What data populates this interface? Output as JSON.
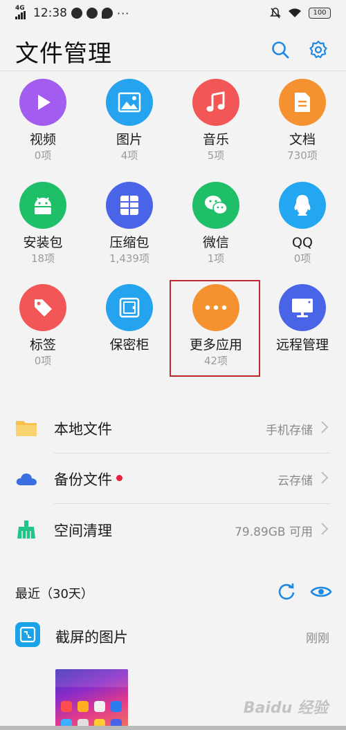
{
  "status_bar": {
    "network": "4G",
    "time": "12:38",
    "more": "···",
    "battery": "100"
  },
  "header": {
    "title": "文件管理"
  },
  "categories": [
    {
      "label": "视频",
      "count": "0项",
      "color": "#a35cf0",
      "icon": "play-icon"
    },
    {
      "label": "图片",
      "count": "4项",
      "color": "#26a3ef",
      "icon": "image-icon"
    },
    {
      "label": "音乐",
      "count": "5项",
      "color": "#f25656",
      "icon": "music-icon"
    },
    {
      "label": "文档",
      "count": "730项",
      "color": "#f5922f",
      "icon": "document-icon"
    },
    {
      "label": "安装包",
      "count": "18项",
      "color": "#1fbf6a",
      "icon": "android-icon"
    },
    {
      "label": "压缩包",
      "count": "1,439项",
      "color": "#4a64e8",
      "icon": "archive-icon"
    },
    {
      "label": "微信",
      "count": "1项",
      "color": "#1fbf6a",
      "icon": "wechat-icon"
    },
    {
      "label": "QQ",
      "count": "0项",
      "color": "#22a7f0",
      "icon": "qq-icon"
    },
    {
      "label": "标签",
      "count": "0项",
      "color": "#f25656",
      "icon": "tag-icon"
    },
    {
      "label": "保密柜",
      "count": "",
      "color": "#26a3ef",
      "icon": "safe-icon"
    },
    {
      "label": "更多应用",
      "count": "42项",
      "color": "#f5922f",
      "icon": "more-icon"
    },
    {
      "label": "远程管理",
      "count": "",
      "color": "#4a64e8",
      "icon": "monitor-icon"
    }
  ],
  "rows": [
    {
      "name": "本地文件",
      "value": "手机存储",
      "icon": "folder-icon",
      "color": "#f6c24b"
    },
    {
      "name": "备份文件",
      "value": "云存储",
      "icon": "cloud-icon",
      "color": "#3b6fe0"
    },
    {
      "name": "空间清理",
      "value": "79.89GB 可用",
      "icon": "broom-icon",
      "color": "#22c48a"
    }
  ],
  "recent": {
    "title": "最近（30天）",
    "item": {
      "name": "截屏的图片",
      "time": "刚刚"
    }
  },
  "watermark": "Baidu 经验",
  "colors": {
    "accent": "#1e88e5",
    "highlight_border": "#c0282d"
  }
}
